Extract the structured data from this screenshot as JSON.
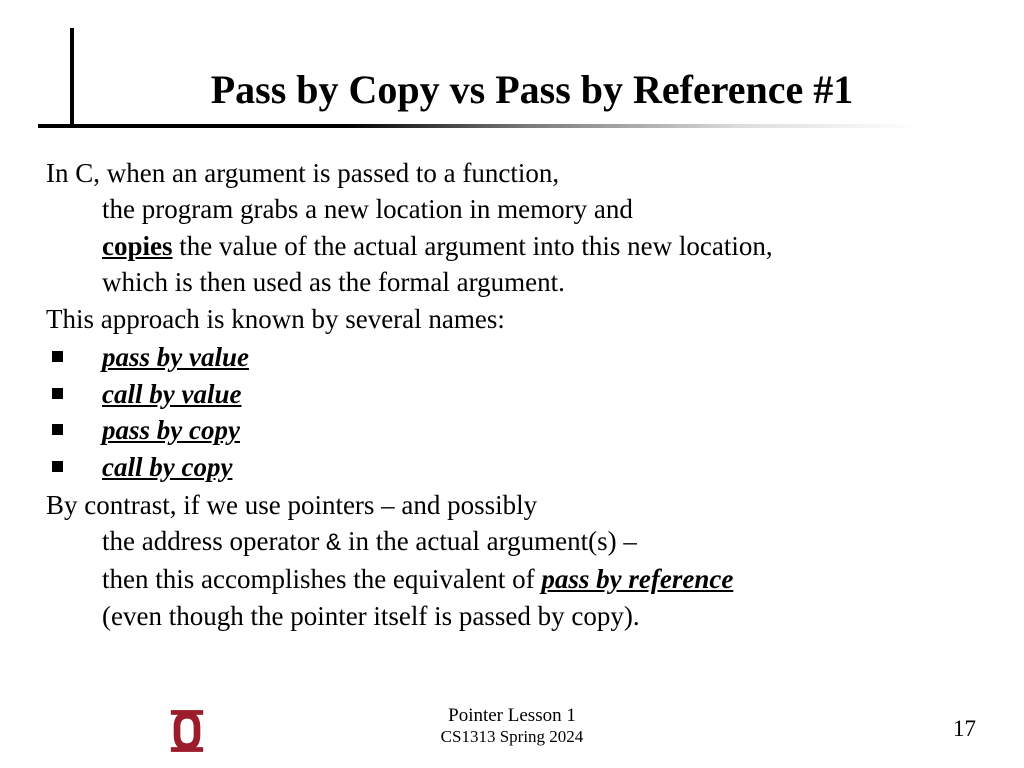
{
  "title": "Pass by Copy vs Pass by Reference #1",
  "para1": {
    "l1": "In C, when an argument is passed to a function,",
    "l2": "the program grabs a new location in memory and",
    "l3_pre": "",
    "l3_bold": "copies",
    "l3_post": " the value of the actual argument into this new location,",
    "l4": "which is then used as the formal argument."
  },
  "para2": "This approach is known by several names:",
  "names": [
    "pass by value",
    "call by value",
    "pass by copy",
    "call by copy"
  ],
  "para3": {
    "l1": "By contrast, if we use pointers – and possibly",
    "l2_pre": "the address operator ",
    "l2_amp": "&",
    "l2_post": " in the actual argument(s) –",
    "l3_pre": "then this accomplishes the equivalent of ",
    "l3_em": "pass by reference",
    "l4": "(even though the pointer itself is passed by copy)."
  },
  "footer": {
    "lesson": "Pointer Lesson 1",
    "course": "CS1313 Spring 2024",
    "page": "17"
  },
  "logo_color": "#9b1c2b"
}
